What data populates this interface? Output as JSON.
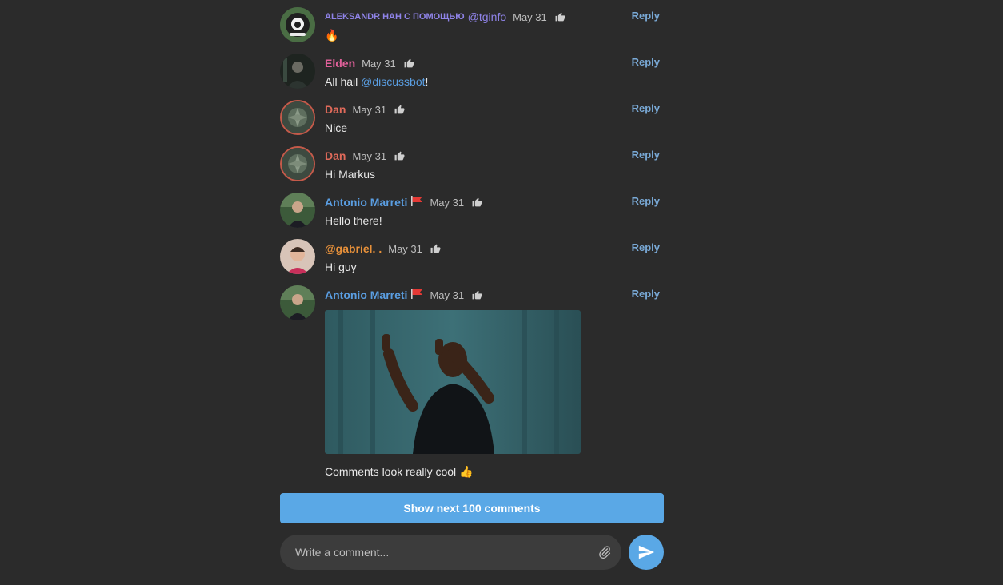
{
  "comments": [
    {
      "author": "ALEKSANDR НАН С ПОМОЩЬЮ",
      "author_mention": "@tginfo",
      "author_color": "#8f83e8",
      "date": "May 31",
      "reply_label": "Reply",
      "text": "🔥",
      "avatar_icon": "owl-logo-avatar"
    },
    {
      "author": "Elden",
      "author_color": "#e0609a",
      "date": "May 31",
      "reply_label": "Reply",
      "text_before": "All hail ",
      "text_mention": "@discussbot",
      "text_after": "!",
      "avatar_icon": "person-avatar"
    },
    {
      "author": "Dan",
      "author_color": "#e06a5a",
      "date": "May 31",
      "reply_label": "Reply",
      "text": "Nice",
      "avatar_icon": "plant-avatar"
    },
    {
      "author": "Dan",
      "author_color": "#e06a5a",
      "date": "May 31",
      "reply_label": "Reply",
      "text": "Hi Markus",
      "avatar_icon": "plant-avatar"
    },
    {
      "author": "Antonio Marreti",
      "author_color": "#5a9ee2",
      "flag": "red-flag-icon",
      "date": "May 31",
      "reply_label": "Reply",
      "text": "Hello there!",
      "avatar_icon": "person-avatar"
    },
    {
      "author": "@gabriel. .",
      "author_color": "#e8913a",
      "date": "May 31",
      "reply_label": "Reply",
      "text": "Hi guy",
      "avatar_icon": "person-avatar"
    },
    {
      "author": "Antonio Marreti",
      "author_color": "#5a9ee2",
      "flag": "red-flag-icon",
      "date": "May 31",
      "reply_label": "Reply",
      "media": "thumbs-up-gif",
      "text": "Comments look really cool 👍",
      "avatar_icon": "person-avatar"
    }
  ],
  "show_more_label": "Show next 100 comments",
  "composer": {
    "placeholder": "Write a comment...",
    "attach_icon": "paperclip-icon",
    "send_icon": "send-icon"
  },
  "colors": {
    "background": "#2b2b2b",
    "accent": "#5aa8e6",
    "link": "#5a9ee2",
    "reply": "#79a9d6"
  }
}
